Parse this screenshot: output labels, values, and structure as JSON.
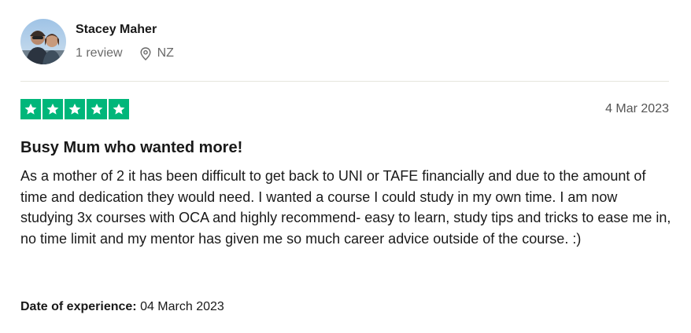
{
  "reviewer": {
    "name": "Stacey Maher",
    "review_count": "1 review",
    "location": "NZ",
    "avatar_icon": "user-avatar-photo",
    "location_icon": "map-pin-icon"
  },
  "rating": {
    "stars": 5,
    "max": 5,
    "color": "#00b67a"
  },
  "review": {
    "date": "4 Mar 2023",
    "title": "Busy Mum who wanted more!",
    "body": "As a mother of 2 it has been difficult to get back to UNI or TAFE financially and due to the amount of time and dedication they would need. I wanted a course I could study in my own time. I am now studying 3x courses with OCA and highly recommend- easy to learn, study tips and tricks to ease me in, no time limit and my mentor has given me so much career advice outside of the course. :)",
    "experience_label": "Date of experience:",
    "experience_date": "04 March 2023"
  }
}
